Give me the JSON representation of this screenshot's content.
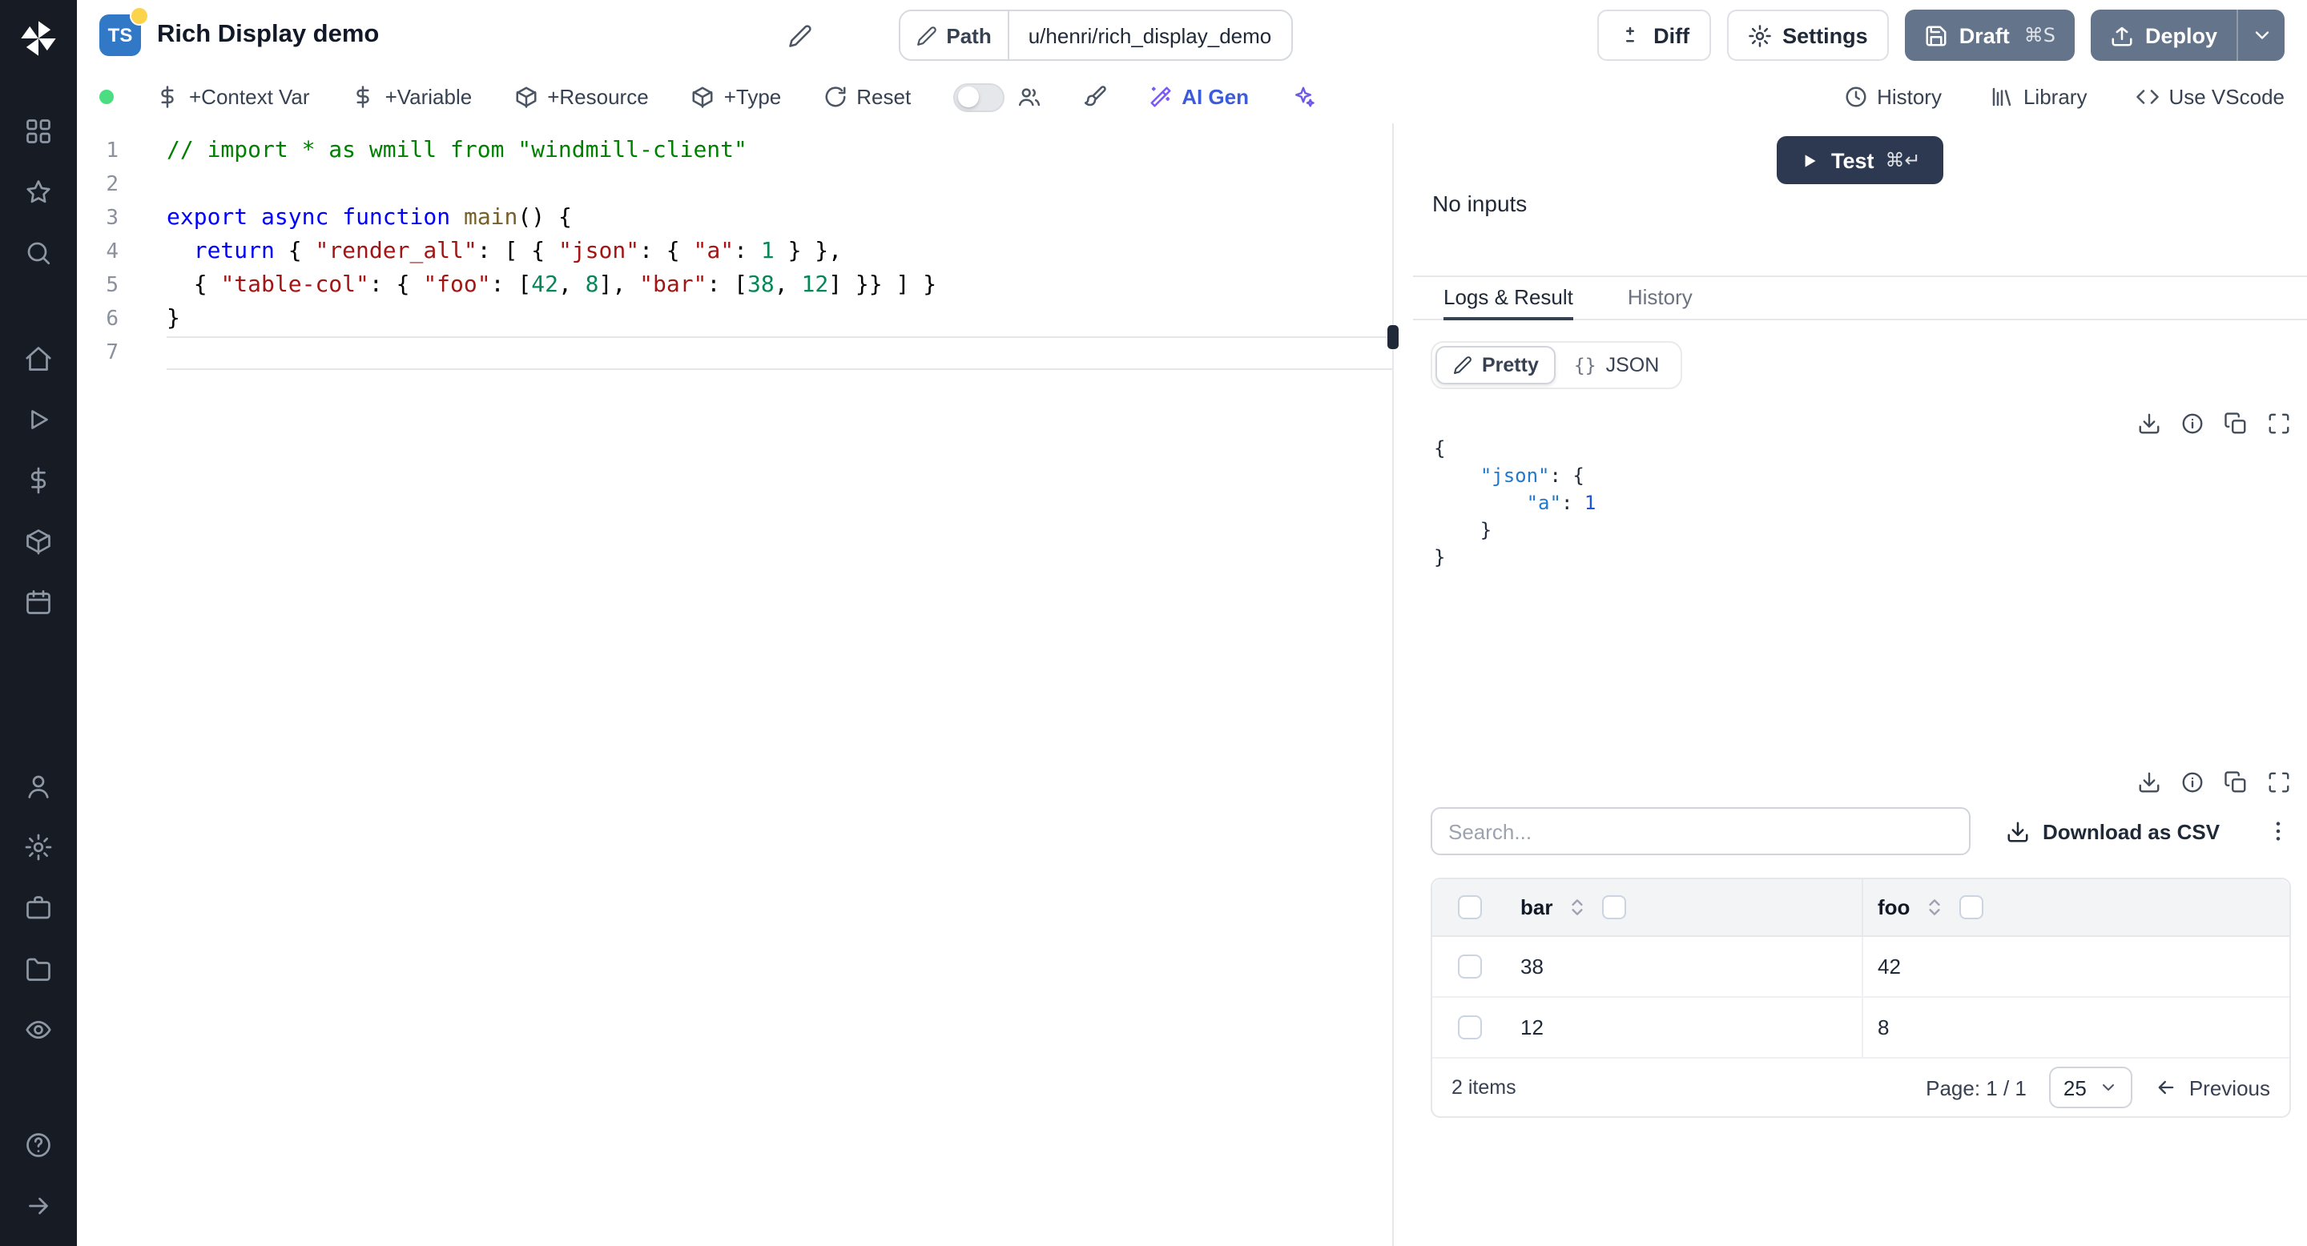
{
  "header": {
    "language_badge": "TS",
    "title": "Rich Display demo",
    "path_label": "Path",
    "path_value": "u/henri/rich_display_demo",
    "diff": "Diff",
    "settings": "Settings",
    "draft": "Draft",
    "draft_shortcut": "⌘S",
    "deploy": "Deploy"
  },
  "toolbar": {
    "context_var": "+Context Var",
    "variable": "+Variable",
    "resource": "+Resource",
    "type": "+Type",
    "reset": "Reset",
    "ai_gen": "AI Gen",
    "history": "History",
    "library": "Library",
    "vscode": "Use VScode"
  },
  "editor": {
    "lines": [
      {
        "n": "1",
        "tokens": [
          {
            "c": "com",
            "t": "// import * as wmill from \"windmill-client\""
          }
        ]
      },
      {
        "n": "2",
        "tokens": []
      },
      {
        "n": "3",
        "tokens": [
          {
            "c": "kw",
            "t": "export"
          },
          {
            "t": " "
          },
          {
            "c": "kw",
            "t": "async"
          },
          {
            "t": " "
          },
          {
            "c": "kw",
            "t": "function"
          },
          {
            "t": " "
          },
          {
            "c": "fn",
            "t": "main"
          },
          {
            "t": "() {"
          }
        ]
      },
      {
        "n": "4",
        "tokens": [
          {
            "t": "  "
          },
          {
            "c": "kw",
            "t": "return"
          },
          {
            "t": " { "
          },
          {
            "c": "str",
            "t": "\"render_all\""
          },
          {
            "t": ": [ { "
          },
          {
            "c": "str",
            "t": "\"json\""
          },
          {
            "t": ": { "
          },
          {
            "c": "str",
            "t": "\"a\""
          },
          {
            "t": ": "
          },
          {
            "c": "num",
            "t": "1"
          },
          {
            "t": " } },"
          }
        ]
      },
      {
        "n": "5",
        "tokens": [
          {
            "t": "  { "
          },
          {
            "c": "str",
            "t": "\"table-col\""
          },
          {
            "t": ": { "
          },
          {
            "c": "str",
            "t": "\"foo\""
          },
          {
            "t": ": ["
          },
          {
            "c": "num",
            "t": "42"
          },
          {
            "t": ", "
          },
          {
            "c": "num",
            "t": "8"
          },
          {
            "t": "], "
          },
          {
            "c": "str",
            "t": "\"bar\""
          },
          {
            "t": ": ["
          },
          {
            "c": "num",
            "t": "38"
          },
          {
            "t": ", "
          },
          {
            "c": "num",
            "t": "12"
          },
          {
            "t": "] }} ] }"
          }
        ]
      },
      {
        "n": "6",
        "tokens": [
          {
            "t": "}"
          }
        ]
      },
      {
        "n": "7",
        "tokens": [],
        "current": true
      }
    ]
  },
  "run": {
    "no_inputs": "No inputs",
    "test": "Test",
    "test_shortcut": "⌘↵"
  },
  "result": {
    "tabs": [
      {
        "label": "Logs & Result",
        "active": true
      },
      {
        "label": "History",
        "active": false
      }
    ],
    "views": [
      {
        "label": "Pretty",
        "active": true
      },
      {
        "label": "JSON",
        "icon": "{}",
        "active": false
      }
    ],
    "json_lines": [
      [
        {
          "t": "{"
        }
      ],
      [
        {
          "t": "    "
        },
        {
          "c": "jkey",
          "t": "\"json\""
        },
        {
          "t": ": {"
        }
      ],
      [
        {
          "t": "        "
        },
        {
          "c": "jkey",
          "t": "\"a\""
        },
        {
          "t": ": "
        },
        {
          "c": "jnum",
          "t": "1"
        }
      ],
      [
        {
          "t": "    }"
        }
      ],
      [
        {
          "t": "}"
        }
      ]
    ],
    "table": {
      "search_placeholder": "Search...",
      "download_csv": "Download as CSV",
      "columns": [
        "bar",
        "foo"
      ],
      "rows": [
        [
          "38",
          "42"
        ],
        [
          "12",
          "8"
        ]
      ],
      "items_label": "2 items",
      "page_label": "Page: 1 / 1",
      "page_size": "25",
      "previous": "Previous"
    }
  },
  "colors": {
    "sidebar_bg": "#161b24",
    "primary_button": "#64748b",
    "test_button": "#2c3950",
    "ai_accent": "#3b5bdb",
    "status_dot": "#4ade80",
    "typescript_blue": "#3178c6"
  },
  "icons": [
    "windmill-logo",
    "grid",
    "star",
    "search",
    "home",
    "play",
    "dollar",
    "package",
    "calendar",
    "user",
    "gear",
    "briefcase",
    "folder",
    "eye",
    "help",
    "arrow-right",
    "pencil",
    "diff",
    "settings-gear",
    "save",
    "deploy-upload",
    "chevron-down",
    "rotate",
    "users",
    "brush",
    "wand",
    "sparkles",
    "clock",
    "library",
    "code",
    "download",
    "info",
    "copy",
    "expand",
    "kebab",
    "sort"
  ]
}
